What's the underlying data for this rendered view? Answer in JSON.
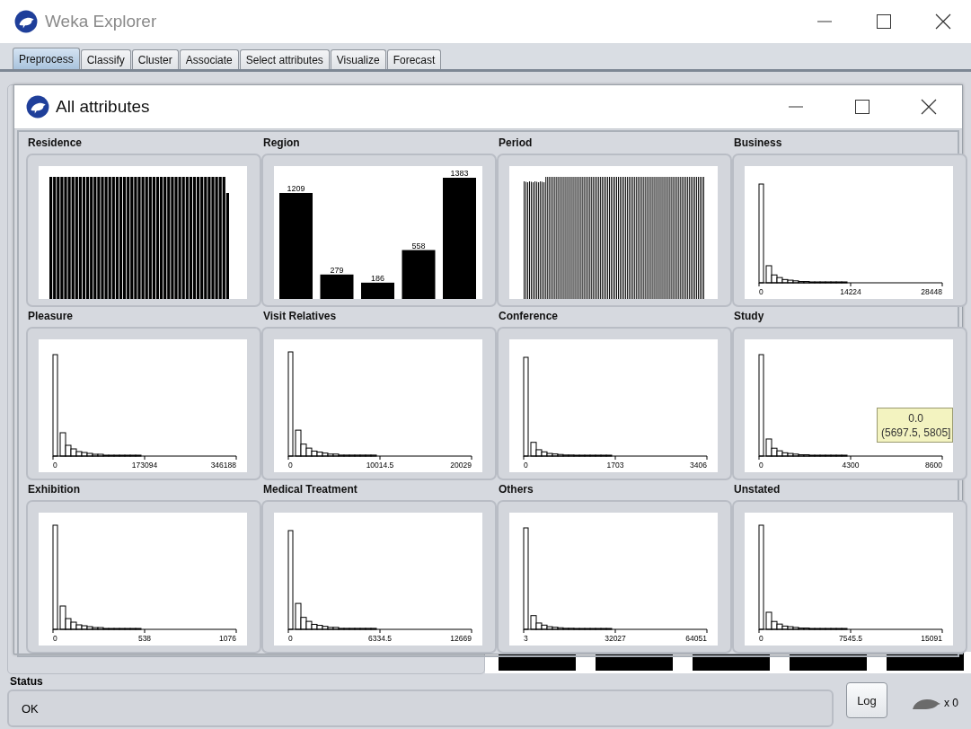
{
  "window": {
    "title": "Weka Explorer"
  },
  "tabs": [
    {
      "label": "Preprocess",
      "selected": true
    },
    {
      "label": "Classify",
      "selected": false
    },
    {
      "label": "Cluster",
      "selected": false
    },
    {
      "label": "Associate",
      "selected": false
    },
    {
      "label": "Select attributes",
      "selected": false
    },
    {
      "label": "Visualize",
      "selected": false
    },
    {
      "label": "Forecast",
      "selected": false
    }
  ],
  "dialog": {
    "title": "All attributes",
    "attributes": [
      {
        "name": "Residence",
        "kind": "dense"
      },
      {
        "name": "Region",
        "kind": "labeled",
        "bar_labels": [
          "1209",
          "279",
          "186",
          "558",
          "1383"
        ]
      },
      {
        "name": "Period",
        "kind": "thin"
      },
      {
        "name": "Business",
        "kind": "numeric",
        "ticks": [
          "0",
          "14224",
          "28448"
        ]
      },
      {
        "name": "Pleasure",
        "kind": "numeric",
        "ticks": [
          "0",
          "173094",
          "346188"
        ]
      },
      {
        "name": "Visit Relatives",
        "kind": "numeric",
        "ticks": [
          "0",
          "10014.5",
          "20029"
        ]
      },
      {
        "name": "Conference",
        "kind": "numeric",
        "ticks": [
          "0",
          "1703",
          "3406"
        ]
      },
      {
        "name": "Study",
        "kind": "numeric",
        "ticks": [
          "0",
          "4300",
          "8600"
        ],
        "tooltip": {
          "value": "0.0",
          "range": "(5697.5, 5805]"
        }
      },
      {
        "name": "Exhibition",
        "kind": "numeric",
        "ticks": [
          "0",
          "538",
          "1076"
        ]
      },
      {
        "name": "Medical Treatment",
        "kind": "numeric",
        "ticks": [
          "0",
          "6334.5",
          "12669"
        ]
      },
      {
        "name": "Others",
        "kind": "numeric",
        "ticks": [
          "3",
          "32027",
          "64051"
        ]
      },
      {
        "name": "Unstated",
        "kind": "numeric",
        "ticks": [
          "0",
          "7545.5",
          "15091"
        ]
      }
    ]
  },
  "status": {
    "label": "Status",
    "message": "OK"
  },
  "log_button": "Log",
  "task_count": "x 0"
}
